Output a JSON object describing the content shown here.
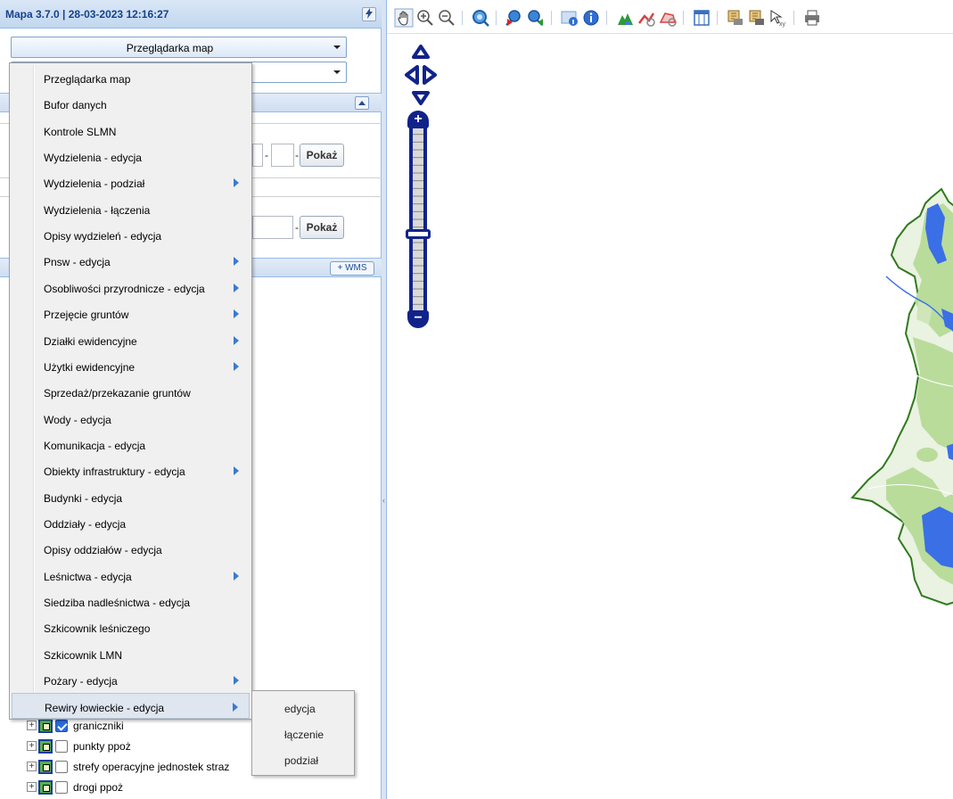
{
  "app": {
    "title": "Mapa 3.7.0 | 28-03-2023 12:16:27"
  },
  "left_panel": {
    "module_combo": {
      "selected": "Przeglądarka map"
    },
    "second_combo": {
      "selected": ""
    },
    "search_group_1": {
      "button_label": "Pokaż"
    },
    "search_group_2": {
      "button_label": "Pokaż"
    },
    "layers_header": {
      "wms_button_label": "+ WMS"
    },
    "layer_tree": [
      {
        "label": "graniczniki",
        "checked": true
      },
      {
        "label": "punkty ppoż",
        "checked": false
      },
      {
        "label": "strefy operacyjne jednostek straz",
        "checked": false
      },
      {
        "label": "drogi ppoż",
        "checked": false
      }
    ]
  },
  "module_menu": {
    "items": [
      {
        "label": "Przeglądarka map",
        "has_submenu": false
      },
      {
        "label": "Bufor danych",
        "has_submenu": false
      },
      {
        "label": "Kontrole SLMN",
        "has_submenu": false
      },
      {
        "label": "Wydzielenia - edycja",
        "has_submenu": false
      },
      {
        "label": "Wydzielenia - podział",
        "has_submenu": true
      },
      {
        "label": "Wydzielenia - łączenia",
        "has_submenu": false
      },
      {
        "label": "Opisy wydzieleń - edycja",
        "has_submenu": false
      },
      {
        "label": "Pnsw - edycja",
        "has_submenu": true
      },
      {
        "label": "Osobliwości przyrodnicze - edycja",
        "has_submenu": true
      },
      {
        "label": "Przejęcie gruntów",
        "has_submenu": true
      },
      {
        "label": "Działki ewidencyjne",
        "has_submenu": true
      },
      {
        "label": "Użytki ewidencyjne",
        "has_submenu": true
      },
      {
        "label": "Sprzedaż/przekazanie gruntów",
        "has_submenu": false
      },
      {
        "label": "Wody - edycja",
        "has_submenu": false
      },
      {
        "label": "Komunikacja - edycja",
        "has_submenu": false
      },
      {
        "label": "Obiekty infrastruktury - edycja",
        "has_submenu": true
      },
      {
        "label": "Budynki - edycja",
        "has_submenu": false
      },
      {
        "label": "Oddziały - edycja",
        "has_submenu": false
      },
      {
        "label": "Opisy oddziałów - edycja",
        "has_submenu": false
      },
      {
        "label": "Leśnictwa - edycja",
        "has_submenu": true
      },
      {
        "label": "Siedziba nadleśnictwa - edycja",
        "has_submenu": false
      },
      {
        "label": "Szkicownik leśniczego",
        "has_submenu": false
      },
      {
        "label": "Szkicownik LMN",
        "has_submenu": false
      },
      {
        "label": "Pożary - edycja",
        "has_submenu": true
      },
      {
        "label": "Rewiry łowieckie - edycja",
        "has_submenu": true,
        "active": true
      }
    ],
    "submenu": {
      "parent": "Rewiry łowieckie - edycja",
      "items": [
        {
          "label": "edycja"
        },
        {
          "label": "łączenie"
        },
        {
          "label": "podział"
        }
      ]
    }
  },
  "toolbar": {
    "tools": [
      "pan-hand-icon",
      "zoom-in-icon",
      "zoom-out-icon",
      "full-extent-icon",
      "zoom-previous-icon",
      "zoom-next-icon",
      "identify-icon",
      "info-icon",
      "home-icon",
      "measure-length-icon",
      "measure-area-icon",
      "table-icon",
      "print-area-icon",
      "print-area-2-icon",
      "coordinates-icon",
      "print-icon"
    ]
  },
  "map": {
    "zoom_level": 14,
    "zoom_levels": 24,
    "colors": {
      "boundary": "#2f7a1c",
      "forest": "#b9dc9b",
      "water": "#3a6fe6",
      "nav_control": "#11238a"
    }
  }
}
